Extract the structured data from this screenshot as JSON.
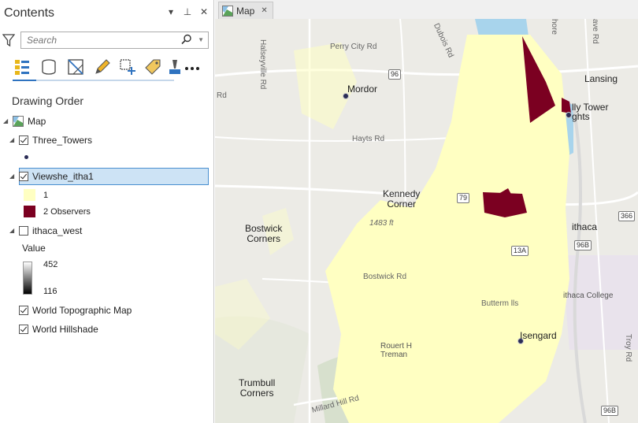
{
  "contents_pane": {
    "title": "Contents",
    "header_buttons": [
      "▾",
      "⊥",
      "✕"
    ],
    "search_placeholder": "Search",
    "toolbar_icons": [
      "list-by-drawing-order-icon",
      "list-by-source-icon",
      "list-by-selection-icon",
      "list-by-editing-icon",
      "list-by-snapping-icon",
      "list-by-labeling-icon",
      "list-by-perspective-icon",
      "more-options-icon"
    ],
    "section_title": "Drawing Order",
    "map_label": "Map",
    "layers": [
      {
        "name": "Three_Towers",
        "checked": true
      },
      {
        "name": "Viewshe_itha1",
        "checked": true,
        "selected": true
      },
      {
        "name": "ithaca_west",
        "checked": false
      },
      {
        "name": "World Topographic Map",
        "checked": true
      },
      {
        "name": "World Hillshade",
        "checked": true
      }
    ],
    "viewshed_legend": [
      {
        "label": "1",
        "color": "#ffffc2"
      },
      {
        "label": "2 Observers",
        "color": "#7b0021"
      }
    ],
    "value_legend": {
      "title": "Value",
      "high": "452",
      "low": "116"
    }
  },
  "map_view": {
    "tab_label": "Map",
    "tab_close": "✕",
    "place_labels": {
      "mordor": "Mordor",
      "kennedy": "Kennedy\nCorner",
      "bostwick": "Bostwick\nCorners",
      "trumbull": "Trumbull\nCorners",
      "isengard": "Isengard",
      "lansing": "Lansing",
      "ithaca": "ithaca",
      "ithaca_college": "ithaca College",
      "tower": "lly Tower\nghts",
      "rouert": "Rouert H\nTreman",
      "elevation": "1483 ft",
      "buttermilk": "Butterm   lls"
    },
    "road_labels": {
      "perry_city": "Perry City Rd",
      "hayts": "Hayts Rd",
      "bostwick_rd": "Bostwick Rd",
      "millard": "Millard Hill Rd",
      "halseyville": "Halseyville Rd",
      "dubois": "Dubois Rd",
      "troy": "Troy Rd",
      "shore": "hore",
      "ave": "ave Rd",
      "rd_left": "Rd"
    },
    "route_shields": [
      "96",
      "79",
      "13A",
      "96B",
      "366",
      "96B"
    ],
    "colors": {
      "viewshed_visible": "#ffffc2",
      "viewshed_observers": "#7b0021",
      "lake": "#a8d4ec",
      "point": "#2b2d56"
    }
  }
}
